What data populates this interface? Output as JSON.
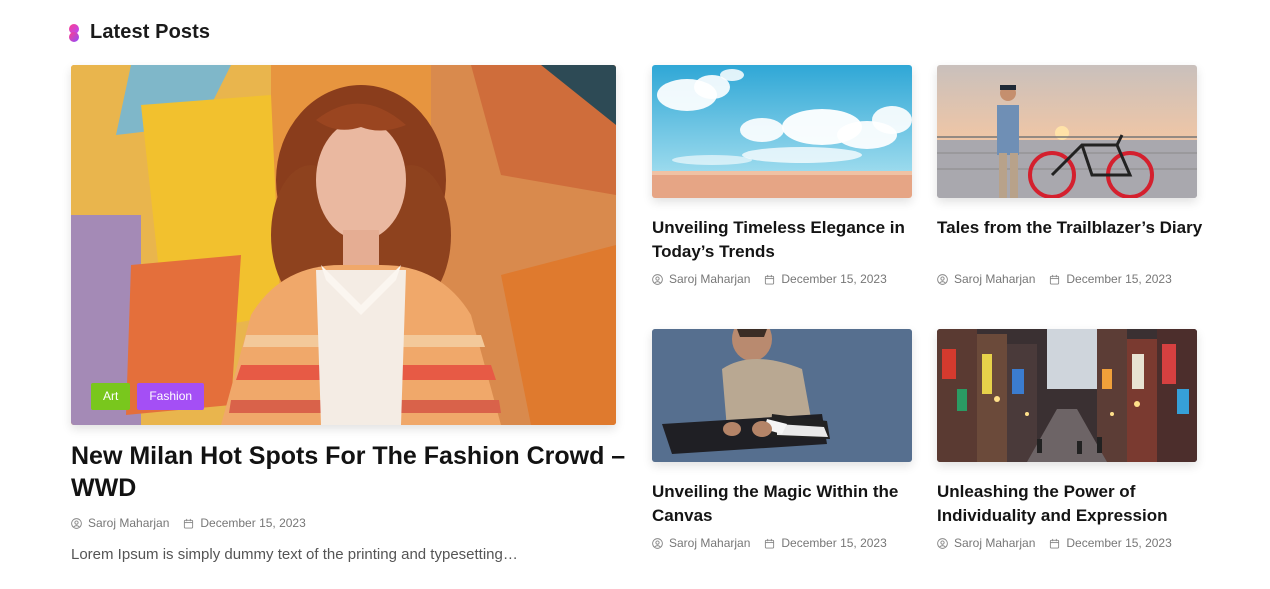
{
  "section": {
    "title": "Latest Posts",
    "icon": "brand-dots-icon"
  },
  "featured": {
    "tags": [
      {
        "label": "Art",
        "color": "#79c71d"
      },
      {
        "label": "Fashion",
        "color": "#a44ff5"
      }
    ],
    "title": "New Milan Hot Spots For The Fashion Crowd – WWD",
    "author": "Saroj Maharjan",
    "date": "December 15, 2023",
    "excerpt": "Lorem Ipsum is simply dummy text of the printing and typesetting…"
  },
  "posts": [
    {
      "title": "Unveiling Timeless Elegance in Today’s Trends",
      "author": "Saroj Maharjan",
      "date": "December 15, 2023"
    },
    {
      "title": "Tales from the Trailblazer’s Diary",
      "author": "Saroj Maharjan",
      "date": "December 15, 2023"
    },
    {
      "title": "Unveiling the Magic Within the Canvas",
      "author": "Saroj Maharjan",
      "date": "December 15, 2023"
    },
    {
      "title": "Unleashing the Power of Individuality and Expression",
      "author": "Saroj Maharjan",
      "date": "December 15, 2023"
    }
  ]
}
